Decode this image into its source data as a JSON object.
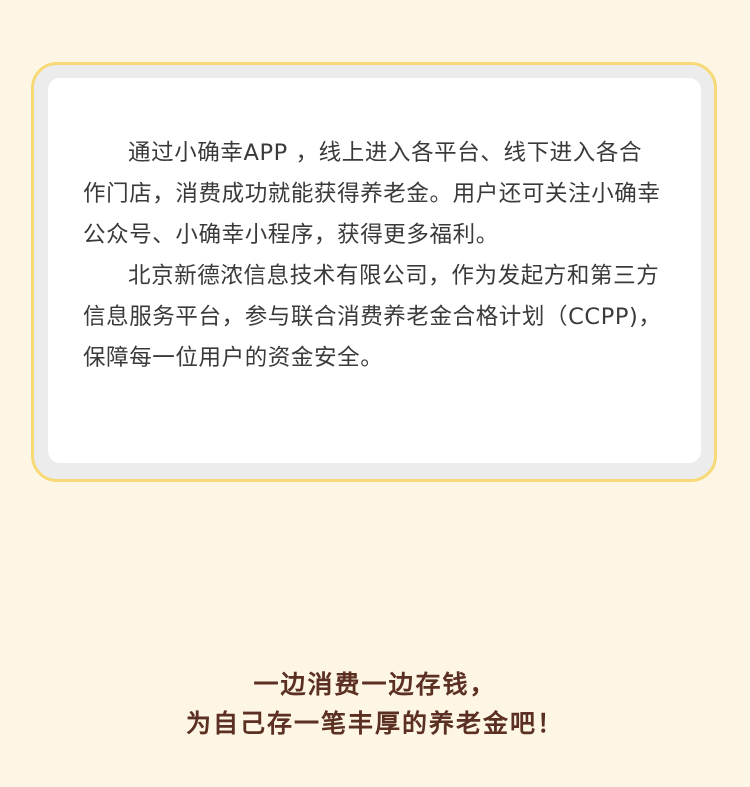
{
  "info_card": {
    "paragraphs": [
      "通过小确幸APP ，线上进入各平台、线下进入各合作门店，消费成功就能获得养老金。用户还可关注小确幸公众号、小确幸小程序，获得更多福利。",
      "北京新德浓信息技术有限公司，作为发起方和第三方信息服务平台，参与联合消费养老金合格计划（CCPP)，保障每一位用户的资金安全。"
    ]
  },
  "slogan": {
    "line1": "一边消费一边存钱，",
    "line2": "为自己存一笔丰厚的养老金吧！"
  },
  "colors": {
    "page_background": "#fef6e4",
    "card_border": "#f7d977",
    "card_frame": "#ececec",
    "card_inner": "#ffffff",
    "body_text": "#3a3a3a",
    "slogan_text": "#5b2f22"
  }
}
